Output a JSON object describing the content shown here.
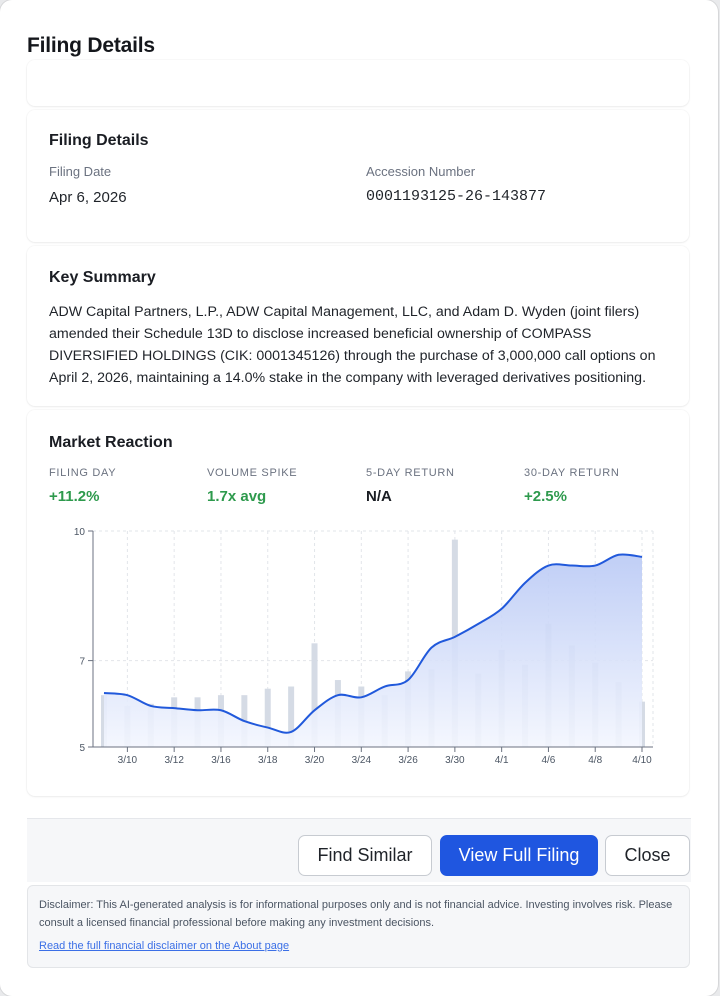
{
  "modal": {
    "title": "Filing Details"
  },
  "filing_details": {
    "title": "Filing Details",
    "date_label": "Filing Date",
    "date_value": "Apr 6, 2026",
    "accession_label": "Accession Number",
    "accession_value": "0001193125-26-143877"
  },
  "key_summary": {
    "title": "Key Summary",
    "text": "ADW Capital Partners, L.P., ADW Capital Management, LLC, and Adam D. Wyden (joint filers) amended their Schedule 13D to disclose increased beneficial ownership of COMPASS DIVERSIFIED HOLDINGS (CIK: 0001345126) through the purchase of 3,000,000 call options on April 2, 2026, maintaining a 14.0% stake in the company with leveraged derivatives positioning."
  },
  "market_reaction": {
    "title": "Market Reaction",
    "stats": [
      {
        "label": "Filing Day",
        "value": "+11.2%",
        "color": "#2e9a4d"
      },
      {
        "label": "Volume Spike",
        "value": "1.7x avg",
        "color": "#2e9a4d"
      },
      {
        "label": "5-Day Return",
        "value": "N/A",
        "color": "#1a1d23"
      },
      {
        "label": "30-Day Return",
        "value": "+2.5%",
        "color": "#2e9a4d"
      }
    ]
  },
  "chart_data": {
    "type": "area",
    "x": [
      "3/9",
      "3/10",
      "3/11",
      "3/12",
      "3/13",
      "3/16",
      "3/17",
      "3/18",
      "3/19",
      "3/20",
      "3/23",
      "3/24",
      "3/25",
      "3/26",
      "3/27",
      "3/30",
      "3/31",
      "4/1",
      "4/2",
      "4/6",
      "4/7",
      "4/8",
      "4/9",
      "4/10"
    ],
    "x_tick_labels": [
      "3/10",
      "3/12",
      "3/16",
      "3/18",
      "3/20",
      "3/24",
      "3/26",
      "3/30",
      "4/1",
      "4/6",
      "4/8",
      "4/10"
    ],
    "y_ticks": [
      5,
      7,
      10
    ],
    "ylim": [
      5,
      10
    ],
    "series": [
      {
        "type": "area",
        "values": [
          6.25,
          6.2,
          5.95,
          5.9,
          5.85,
          5.85,
          5.6,
          5.45,
          5.35,
          5.85,
          6.2,
          6.15,
          6.4,
          6.55,
          7.3,
          7.55,
          7.85,
          8.2,
          8.8,
          9.2,
          9.2,
          9.2,
          9.45,
          9.4
        ]
      },
      {
        "type": "volume_bar",
        "values": [
          6.2,
          5.95,
          6.0,
          6.15,
          6.15,
          6.2,
          6.2,
          6.35,
          6.4,
          7.4,
          6.55,
          6.4,
          6.2,
          6.75,
          6.8,
          9.8,
          6.7,
          7.25,
          6.9,
          7.85,
          7.35,
          6.95,
          6.5,
          6.05
        ]
      }
    ],
    "colors": {
      "line": "#2159db",
      "area_top": "#b9c9f5",
      "area_bottom": "#f3f6fe",
      "volume": "#d5dbe5"
    }
  },
  "footer": {
    "find_similar": "Find Similar",
    "view_full": "View Full Filing",
    "close": "Close"
  },
  "disclaimer": {
    "text": "Disclaimer: This AI-generated analysis is for informational purposes only and is not financial advice. Investing involves risk. Please consult a licensed financial professional before making any investment decisions.",
    "link": "Read the full financial disclaimer on the About page"
  }
}
